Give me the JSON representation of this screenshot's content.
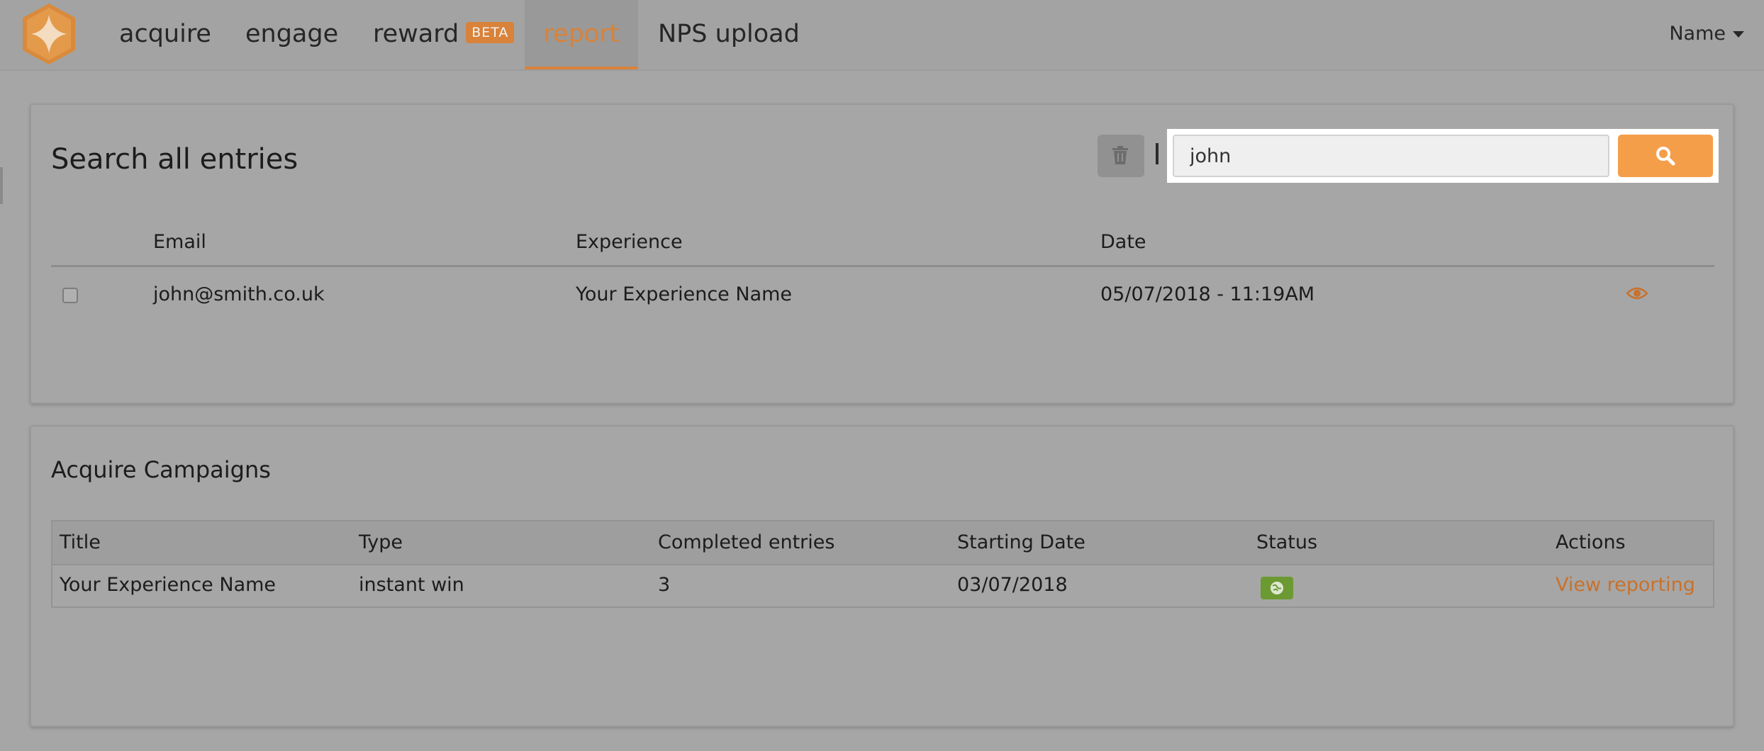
{
  "nav": {
    "items": [
      "acquire",
      "engage",
      "reward",
      "report",
      "NPS upload"
    ],
    "reward_badge": "BETA",
    "active": "report",
    "user_label": "Name"
  },
  "search_panel": {
    "title": "Search all entries",
    "search_value": "john",
    "columns": [
      "Email",
      "Experience",
      "Date"
    ],
    "rows": [
      {
        "email": "john@smith.co.uk",
        "experience": "Your Experience Name",
        "date": "05/07/2018 - 11:19AM"
      }
    ]
  },
  "campaigns": {
    "title": "Acquire Campaigns",
    "columns": [
      "Title",
      "Type",
      "Completed entries",
      "Starting Date",
      "Status",
      "Actions"
    ],
    "rows": [
      {
        "title": "Your Experience Name",
        "type": "instant win",
        "completed": "3",
        "start_date": "03/07/2018",
        "status_icon": "status-active-icon",
        "action": "View reporting"
      }
    ]
  },
  "colors": {
    "accent": "#d9823a",
    "search_button": "#f59e4a",
    "status_active": "#6b9a33"
  }
}
